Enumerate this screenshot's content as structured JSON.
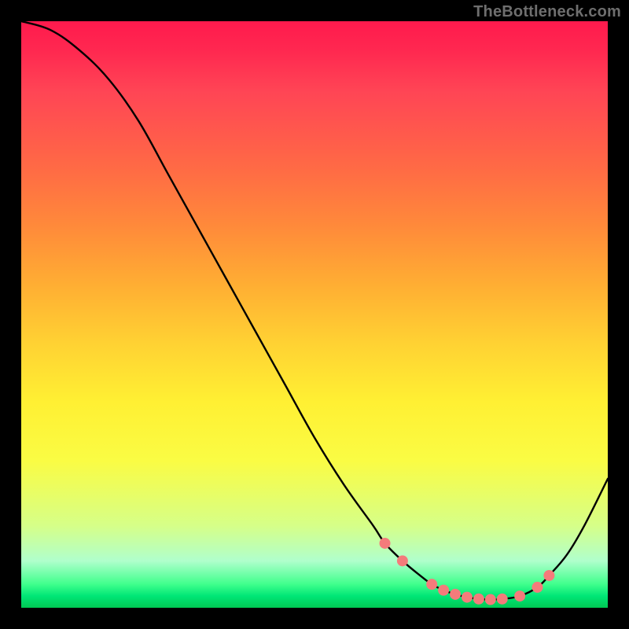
{
  "watermark": "TheBottleneck.com",
  "chart_data": {
    "type": "line",
    "title": "",
    "xlabel": "",
    "ylabel": "",
    "xlim": [
      0,
      100
    ],
    "ylim": [
      0,
      100
    ],
    "series": [
      {
        "name": "bottleneck-curve",
        "x": [
          0,
          5,
          10,
          15,
          20,
          25,
          30,
          35,
          40,
          45,
          50,
          55,
          60,
          62,
          65,
          68,
          70,
          72,
          74,
          76,
          78,
          80,
          82,
          85,
          88,
          90,
          93,
          96,
          100
        ],
        "y": [
          100,
          98.5,
          95,
          90,
          83,
          74,
          65,
          56,
          47,
          38,
          29,
          21,
          14,
          11,
          8,
          5.5,
          4,
          3,
          2.3,
          1.8,
          1.5,
          1.4,
          1.5,
          2,
          3.5,
          5.5,
          9,
          14,
          22
        ]
      }
    ],
    "markers": {
      "name": "highlight-dots",
      "color": "#f47b7b",
      "x": [
        62,
        65,
        70,
        72,
        74,
        76,
        78,
        80,
        82,
        85,
        88,
        90
      ],
      "y": [
        11,
        8,
        4,
        3,
        2.3,
        1.8,
        1.5,
        1.4,
        1.5,
        2,
        3.5,
        5.5
      ]
    }
  }
}
